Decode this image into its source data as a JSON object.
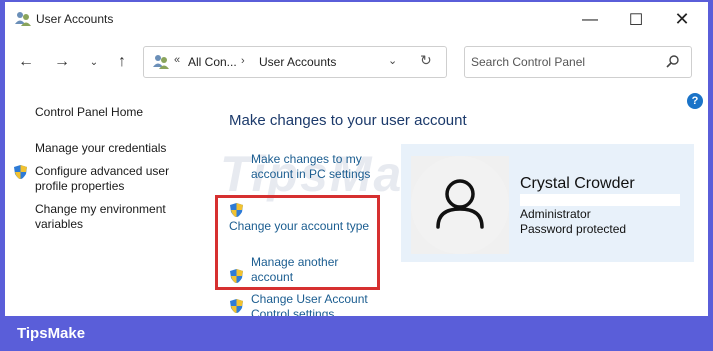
{
  "window": {
    "title": "User Accounts",
    "minimize": "—",
    "maximize": "☐",
    "close": "✕"
  },
  "navigation": {
    "back": "←",
    "forward": "→",
    "recent": "⌄",
    "up": "↑",
    "address": {
      "chevrons": "«",
      "crumb1": "All Con...",
      "separator": "›",
      "crumb2": "User Accounts",
      "dropdown": "⌄",
      "refresh": "↻"
    },
    "search": {
      "placeholder": "Search Control Panel"
    }
  },
  "help": "?",
  "left_panel": {
    "home": "Control Panel Home",
    "credentials": "Manage your credentials",
    "advanced": "Configure advanced user profile properties",
    "environment": "Change my environment variables"
  },
  "main": {
    "heading": "Make changes to your user account",
    "tasks": {
      "pc_settings": "Make changes to my account in PC settings",
      "account_type": "Change your account type",
      "manage_another": "Manage another account",
      "uac_settings": "Change User Account Control settings"
    }
  },
  "user": {
    "name": "Crystal Crowder",
    "role": "Administrator",
    "status": "Password protected"
  },
  "footer": {
    "brand": "TipsMake"
  },
  "colors": {
    "accent_bar": "#5a5ed9",
    "link": "#1b5d90",
    "heading": "#1c3a6b",
    "highlight": "#d63030",
    "card": "#e8f1fa"
  }
}
